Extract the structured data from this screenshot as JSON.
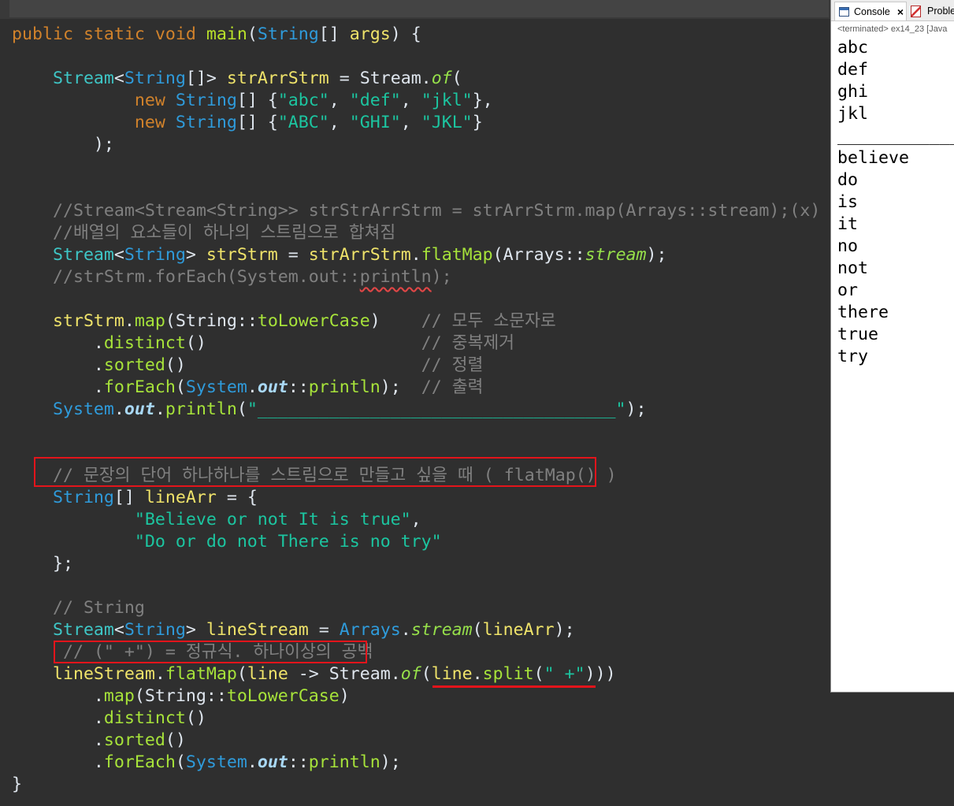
{
  "theme": {
    "editor_bg": "#2f2f2f",
    "annotation_color": "#e3141b"
  },
  "syntax_colors": {
    "kw": "#d1822b",
    "md": "#b8e02a",
    "mt": "#a7e33a",
    "sm": "#96e04a",
    "cl": "#2f9bdb",
    "it": "#3ec6c6",
    "vd": "#efe36a",
    "st": "#1cc5a0",
    "cm": "#808080",
    "cu": "#808080",
    "sf": "#a9d8f6",
    "pl": "#dfe6ee"
  },
  "editor": {
    "lines": [
      [
        {
          "kw": "public"
        },
        {
          "pl": " "
        },
        {
          "kw": "static"
        },
        {
          "pl": " "
        },
        {
          "kw": "void"
        },
        {
          "pl": " "
        },
        {
          "md": "main"
        },
        {
          "pl": "("
        },
        {
          "cl": "String"
        },
        {
          "pl": "[] "
        },
        {
          "vd": "args"
        },
        {
          "pl": ") {"
        }
      ],
      [],
      [
        {
          "pl": "    "
        },
        {
          "it": "Stream"
        },
        {
          "pl": "<"
        },
        {
          "cl": "String"
        },
        {
          "pl": "[]> "
        },
        {
          "vd": "strArrStrm"
        },
        {
          "pl": " = Stream."
        },
        {
          "sm": "of"
        },
        {
          "pl": "("
        }
      ],
      [
        {
          "pl": "            "
        },
        {
          "kw": "new"
        },
        {
          "pl": " "
        },
        {
          "cl": "String"
        },
        {
          "pl": "[] {"
        },
        {
          "st": "\"abc\""
        },
        {
          "pl": ", "
        },
        {
          "st": "\"def\""
        },
        {
          "pl": ", "
        },
        {
          "st": "\"jkl\""
        },
        {
          "pl": "},"
        }
      ],
      [
        {
          "pl": "            "
        },
        {
          "kw": "new"
        },
        {
          "pl": " "
        },
        {
          "cl": "String"
        },
        {
          "pl": "[] {"
        },
        {
          "st": "\"ABC\""
        },
        {
          "pl": ", "
        },
        {
          "st": "\"GHI\""
        },
        {
          "pl": ", "
        },
        {
          "st": "\"JKL\""
        },
        {
          "pl": "}"
        }
      ],
      [
        {
          "pl": "        );"
        }
      ],
      [],
      [],
      [
        {
          "pl": "    "
        },
        {
          "cm": "//Stream<Stream<String>> strStrArrStrm = strArrStrm.map(Arrays::stream);(x)"
        }
      ],
      [
        {
          "pl": "    "
        },
        {
          "cm": "//배열의 요소들이 하나의 스트림으로 합쳐짐"
        }
      ],
      [
        {
          "pl": "    "
        },
        {
          "it": "Stream"
        },
        {
          "pl": "<"
        },
        {
          "cl": "String"
        },
        {
          "pl": "> "
        },
        {
          "vd": "strStrm"
        },
        {
          "pl": " = "
        },
        {
          "vd": "strArrStrm"
        },
        {
          "pl": "."
        },
        {
          "mt": "flatMap"
        },
        {
          "pl": "(Arrays::"
        },
        {
          "sm": "stream"
        },
        {
          "pl": ");"
        }
      ],
      [
        {
          "pl": "    "
        },
        {
          "cm": "//strStrm.forEach(System.out::"
        },
        {
          "cu": "println"
        },
        {
          "cm": ");"
        }
      ],
      [],
      [
        {
          "pl": "    "
        },
        {
          "vd": "strStrm"
        },
        {
          "pl": "."
        },
        {
          "mt": "map"
        },
        {
          "pl": "(String::"
        },
        {
          "mt": "toLowerCase"
        },
        {
          "pl": ")    "
        },
        {
          "cm": "// 모두 소문자로"
        }
      ],
      [
        {
          "pl": "        ."
        },
        {
          "mt": "distinct"
        },
        {
          "pl": "()                     "
        },
        {
          "cm": "// 중복제거"
        }
      ],
      [
        {
          "pl": "        ."
        },
        {
          "mt": "sorted"
        },
        {
          "pl": "()                       "
        },
        {
          "cm": "// 정렬"
        }
      ],
      [
        {
          "pl": "        ."
        },
        {
          "mt": "forEach"
        },
        {
          "pl": "("
        },
        {
          "cl": "System"
        },
        {
          "pl": "."
        },
        {
          "sf": "out"
        },
        {
          "pl": "::"
        },
        {
          "mt": "println"
        },
        {
          "pl": ");  "
        },
        {
          "cm": "// 출력"
        }
      ],
      [
        {
          "pl": "    "
        },
        {
          "cl": "System"
        },
        {
          "pl": "."
        },
        {
          "sf": "out"
        },
        {
          "pl": "."
        },
        {
          "mt": "println"
        },
        {
          "pl": "("
        },
        {
          "st": "\"___________________________________\""
        },
        {
          "pl": ");"
        }
      ],
      [],
      [],
      [
        {
          "pl": "    "
        },
        {
          "cm": "// 문장의 단어 하나하나를 스트림으로 만들고 싶을 때 ( flatMap() )"
        }
      ],
      [
        {
          "pl": "    "
        },
        {
          "cl": "String"
        },
        {
          "pl": "[] "
        },
        {
          "vd": "lineArr"
        },
        {
          "pl": " = {"
        }
      ],
      [
        {
          "pl": "            "
        },
        {
          "st": "\"Believe or not It is true\""
        },
        {
          "pl": ","
        }
      ],
      [
        {
          "pl": "            "
        },
        {
          "st": "\"Do or do not There is no try\""
        }
      ],
      [
        {
          "pl": "    };"
        }
      ],
      [],
      [
        {
          "pl": "    "
        },
        {
          "cm": "// String"
        }
      ],
      [
        {
          "pl": "    "
        },
        {
          "it": "Stream"
        },
        {
          "pl": "<"
        },
        {
          "cl": "String"
        },
        {
          "pl": "> "
        },
        {
          "vd": "lineStream"
        },
        {
          "pl": " = "
        },
        {
          "cl": "Arrays"
        },
        {
          "pl": "."
        },
        {
          "sm": "stream"
        },
        {
          "pl": "("
        },
        {
          "vd": "lineArr"
        },
        {
          "pl": ");"
        }
      ],
      [
        {
          "pl": "     "
        },
        {
          "cm": "// (\" +\") = 정규식. 하나이상의 공백"
        }
      ],
      [
        {
          "pl": "    "
        },
        {
          "vd": "lineStream"
        },
        {
          "pl": "."
        },
        {
          "mt": "flatMap"
        },
        {
          "pl": "("
        },
        {
          "vd": "line"
        },
        {
          "pl": " -> Stream."
        },
        {
          "sm": "of"
        },
        {
          "pl": "("
        },
        {
          "vd": "line"
        },
        {
          "pl": "."
        },
        {
          "mt": "split"
        },
        {
          "pl": "("
        },
        {
          "st": "\" +\""
        },
        {
          "pl": ")))"
        }
      ],
      [
        {
          "pl": "        ."
        },
        {
          "mt": "map"
        },
        {
          "pl": "(String::"
        },
        {
          "mt": "toLowerCase"
        },
        {
          "pl": ")"
        }
      ],
      [
        {
          "pl": "        ."
        },
        {
          "mt": "distinct"
        },
        {
          "pl": "()"
        }
      ],
      [
        {
          "pl": "        ."
        },
        {
          "mt": "sorted"
        },
        {
          "pl": "()"
        }
      ],
      [
        {
          "pl": "        ."
        },
        {
          "mt": "forEach"
        },
        {
          "pl": "("
        },
        {
          "cl": "System"
        },
        {
          "pl": "."
        },
        {
          "sf": "out"
        },
        {
          "pl": "::"
        },
        {
          "mt": "println"
        },
        {
          "pl": ");"
        }
      ],
      [
        {
          "pl": "}"
        }
      ]
    ]
  },
  "console": {
    "tabs": [
      {
        "label": "Console",
        "icon": "console-icon",
        "close": "×"
      },
      {
        "label": "Probler",
        "icon": "problems-icon"
      }
    ],
    "status": "<terminated> ex14_23 [Java",
    "output": [
      "abc",
      "def",
      "ghi",
      "jkl",
      "___________________________________",
      "believe",
      "do",
      "is",
      "it",
      "no",
      "not",
      "or",
      "there",
      "true",
      "try"
    ]
  }
}
